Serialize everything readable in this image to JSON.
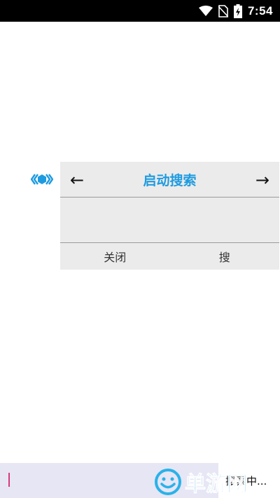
{
  "status_bar": {
    "time": "7:54",
    "icons": [
      "wifi-icon",
      "no-sim-icon",
      "battery-charging-icon"
    ]
  },
  "float_handle": {
    "glyph": "《●》",
    "color": "#1e9be0"
  },
  "panel": {
    "prev_label": "←",
    "title": "启动搜索",
    "next_label": "→",
    "close_label": "关闭",
    "search_label": "搜"
  },
  "bottom_bar": {
    "input_value": "",
    "status_text": "搜索中..."
  },
  "watermark": {
    "text": "单游网",
    "color": "#2ab2e8"
  },
  "colors": {
    "accent": "#1e9be0",
    "panel_bg": "#ebebeb",
    "input_bg": "#e6e6f5",
    "caret": "#d63a7a"
  }
}
